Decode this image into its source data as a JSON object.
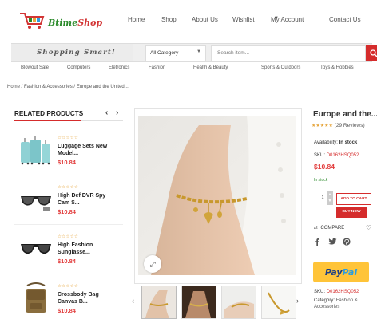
{
  "brand": {
    "part1": "Btime",
    "part2": "Shop"
  },
  "nav": [
    {
      "label": "Home"
    },
    {
      "label": "Shop"
    },
    {
      "label": "About Us"
    },
    {
      "label": "Wishlist"
    },
    {
      "label": "My Account"
    },
    {
      "label": "Contact Us"
    }
  ],
  "search": {
    "slogan": "Shopping Smart!",
    "category": "All Category",
    "placeholder": "Search item..."
  },
  "categories": [
    "Blowout Sale",
    "Computers",
    "Eletronics",
    "Fashion",
    "Health & Beauty",
    "Sports & Outdoors",
    "Toys & Hobbies"
  ],
  "breadcrumb": "Home / Fashion & Accessories / Europe and the United ...",
  "related": {
    "title": "RELATED PRODUCTS",
    "items": [
      {
        "stars": "☆☆☆☆☆",
        "name1": "Luggage Sets New",
        "name2": "Model...",
        "price": "$10.84"
      },
      {
        "stars": "☆☆☆☆☆",
        "name1": "High Def DVR Spy",
        "name2": "Cam S...",
        "price": "$10.84"
      },
      {
        "stars": "☆☆☆☆☆",
        "name1": "High Fashion",
        "name2": "Sunglasse...",
        "price": "$10.84"
      },
      {
        "stars": "☆☆☆☆☆",
        "name1": "Crossbody Bag",
        "name2": "Canvas B...",
        "price": "$10.84"
      }
    ]
  },
  "product": {
    "title": "Europe and the...",
    "stars": "★★★★★",
    "reviews": "(29 Reviews)",
    "availability_label": "Availability:",
    "availability_value": "In stock",
    "sku_label": "SKU:",
    "sku": "D0162HSQ052",
    "price": "$10.84",
    "stock_text": "In stock",
    "qty": "1",
    "add_to_cart": "ADD TO CART",
    "buy_now": "BUY NOW",
    "compare": "COMPARE",
    "paypal1": "Pay",
    "paypal2": "Pal",
    "category_label": "Category:",
    "category_value": "Fashion & Accessories"
  },
  "colors": {
    "accent": "#d52c2c",
    "price": "#e23c3c",
    "stars": "#e6a63d",
    "paypal": "#ffc439"
  }
}
